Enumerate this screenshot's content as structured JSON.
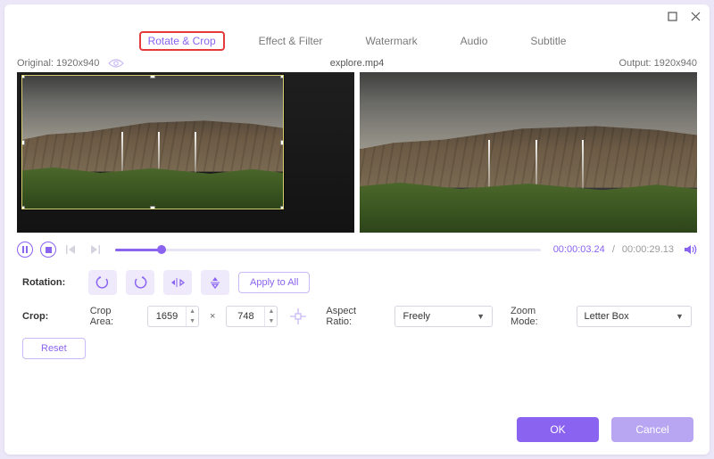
{
  "tabs": [
    "Rotate & Crop",
    "Effect & Filter",
    "Watermark",
    "Audio",
    "Subtitle"
  ],
  "activeTab": 0,
  "info": {
    "original_label": "Original:",
    "original_dims": "1920x940",
    "filename": "explore.mp4",
    "output_label": "Output:",
    "output_dims": "1920x940"
  },
  "player": {
    "current": "00:00:03.24",
    "total": "00:00:29.13"
  },
  "rotation": {
    "label": "Rotation:",
    "apply_all": "Apply to All",
    "icons": [
      "rotate-left-icon",
      "rotate-right-icon",
      "flip-horizontal-icon",
      "flip-vertical-icon"
    ]
  },
  "crop": {
    "label": "Crop:",
    "area_label": "Crop Area:",
    "width": "1659",
    "height": "748",
    "aspect_label": "Aspect Ratio:",
    "aspect_value": "Freely",
    "zoom_label": "Zoom Mode:",
    "zoom_value": "Letter Box",
    "reset": "Reset"
  },
  "footer": {
    "ok": "OK",
    "cancel": "Cancel"
  }
}
